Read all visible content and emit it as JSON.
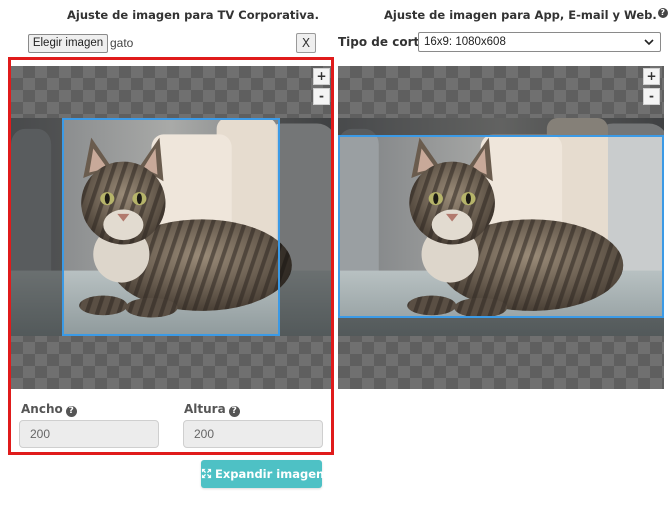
{
  "left_panel": {
    "title": "Ajuste de imagen para TV Corporativa.",
    "choose_button": "Elegir imagen",
    "file_name": "gato",
    "clear_button": "X",
    "zoom_in": "+",
    "zoom_out": "-",
    "width_label": "Ancho",
    "height_label": "Altura",
    "width_value": "200",
    "height_value": "200",
    "expand_button": "Expandir imagen"
  },
  "right_panel": {
    "title": "Ajuste de imagen para App, E-mail y Web.",
    "help_symbol": "?",
    "cut_type_label": "Tipo de corte:",
    "cut_type_selected": "16x9: 1080x608",
    "zoom_in": "+",
    "zoom_out": "-"
  },
  "colors": {
    "highlight_border": "#e01b1b",
    "crop_border": "#3b9ae6",
    "expand_button_bg": "#4ec1c5"
  }
}
